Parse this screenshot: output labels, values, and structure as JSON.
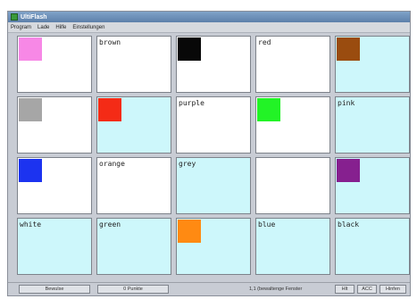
{
  "window": {
    "title": "UltiFlash",
    "icon": "app-icon"
  },
  "menu": [
    "Program",
    "Lade",
    "Hilfe",
    "Einstellungen"
  ],
  "cards": [
    {
      "kind": "swatch",
      "color": "#f788e6",
      "bg": "white"
    },
    {
      "kind": "word",
      "text": "brown",
      "bg": "white"
    },
    {
      "kind": "swatch",
      "color": "#080808",
      "bg": "white"
    },
    {
      "kind": "word",
      "text": "red",
      "bg": "white"
    },
    {
      "kind": "swatch",
      "color": "#9a4c0f",
      "bg": "cyan"
    },
    {
      "kind": "swatch",
      "color": "#a6a6a6",
      "bg": "white"
    },
    {
      "kind": "swatch",
      "color": "#f42b16",
      "bg": "cyan"
    },
    {
      "kind": "word",
      "text": "purple",
      "bg": "white"
    },
    {
      "kind": "swatch",
      "color": "#22f326",
      "bg": "white"
    },
    {
      "kind": "word",
      "text": "pink",
      "bg": "cyan"
    },
    {
      "kind": "swatch",
      "color": "#1c33f0",
      "bg": "white"
    },
    {
      "kind": "word",
      "text": "orange",
      "bg": "white"
    },
    {
      "kind": "word",
      "text": "grey",
      "bg": "cyan"
    },
    {
      "kind": "blank",
      "bg": "white"
    },
    {
      "kind": "swatch",
      "color": "#86208f",
      "bg": "cyan"
    },
    {
      "kind": "word",
      "text": "white",
      "bg": "cyan"
    },
    {
      "kind": "word",
      "text": "green",
      "bg": "cyan"
    },
    {
      "kind": "swatch",
      "color": "#ff8a12",
      "bg": "cyan"
    },
    {
      "kind": "word",
      "text": "blue",
      "bg": "cyan"
    },
    {
      "kind": "word",
      "text": "black",
      "bg": "cyan"
    }
  ],
  "status": {
    "moves_button": "Bewulse",
    "points_button": "0 Punkte",
    "found_label": "1,1 (bewaltenge Fenster",
    "btn_a": "Hlt",
    "btn_b": "ACC",
    "btn_c": "Hinfen"
  }
}
